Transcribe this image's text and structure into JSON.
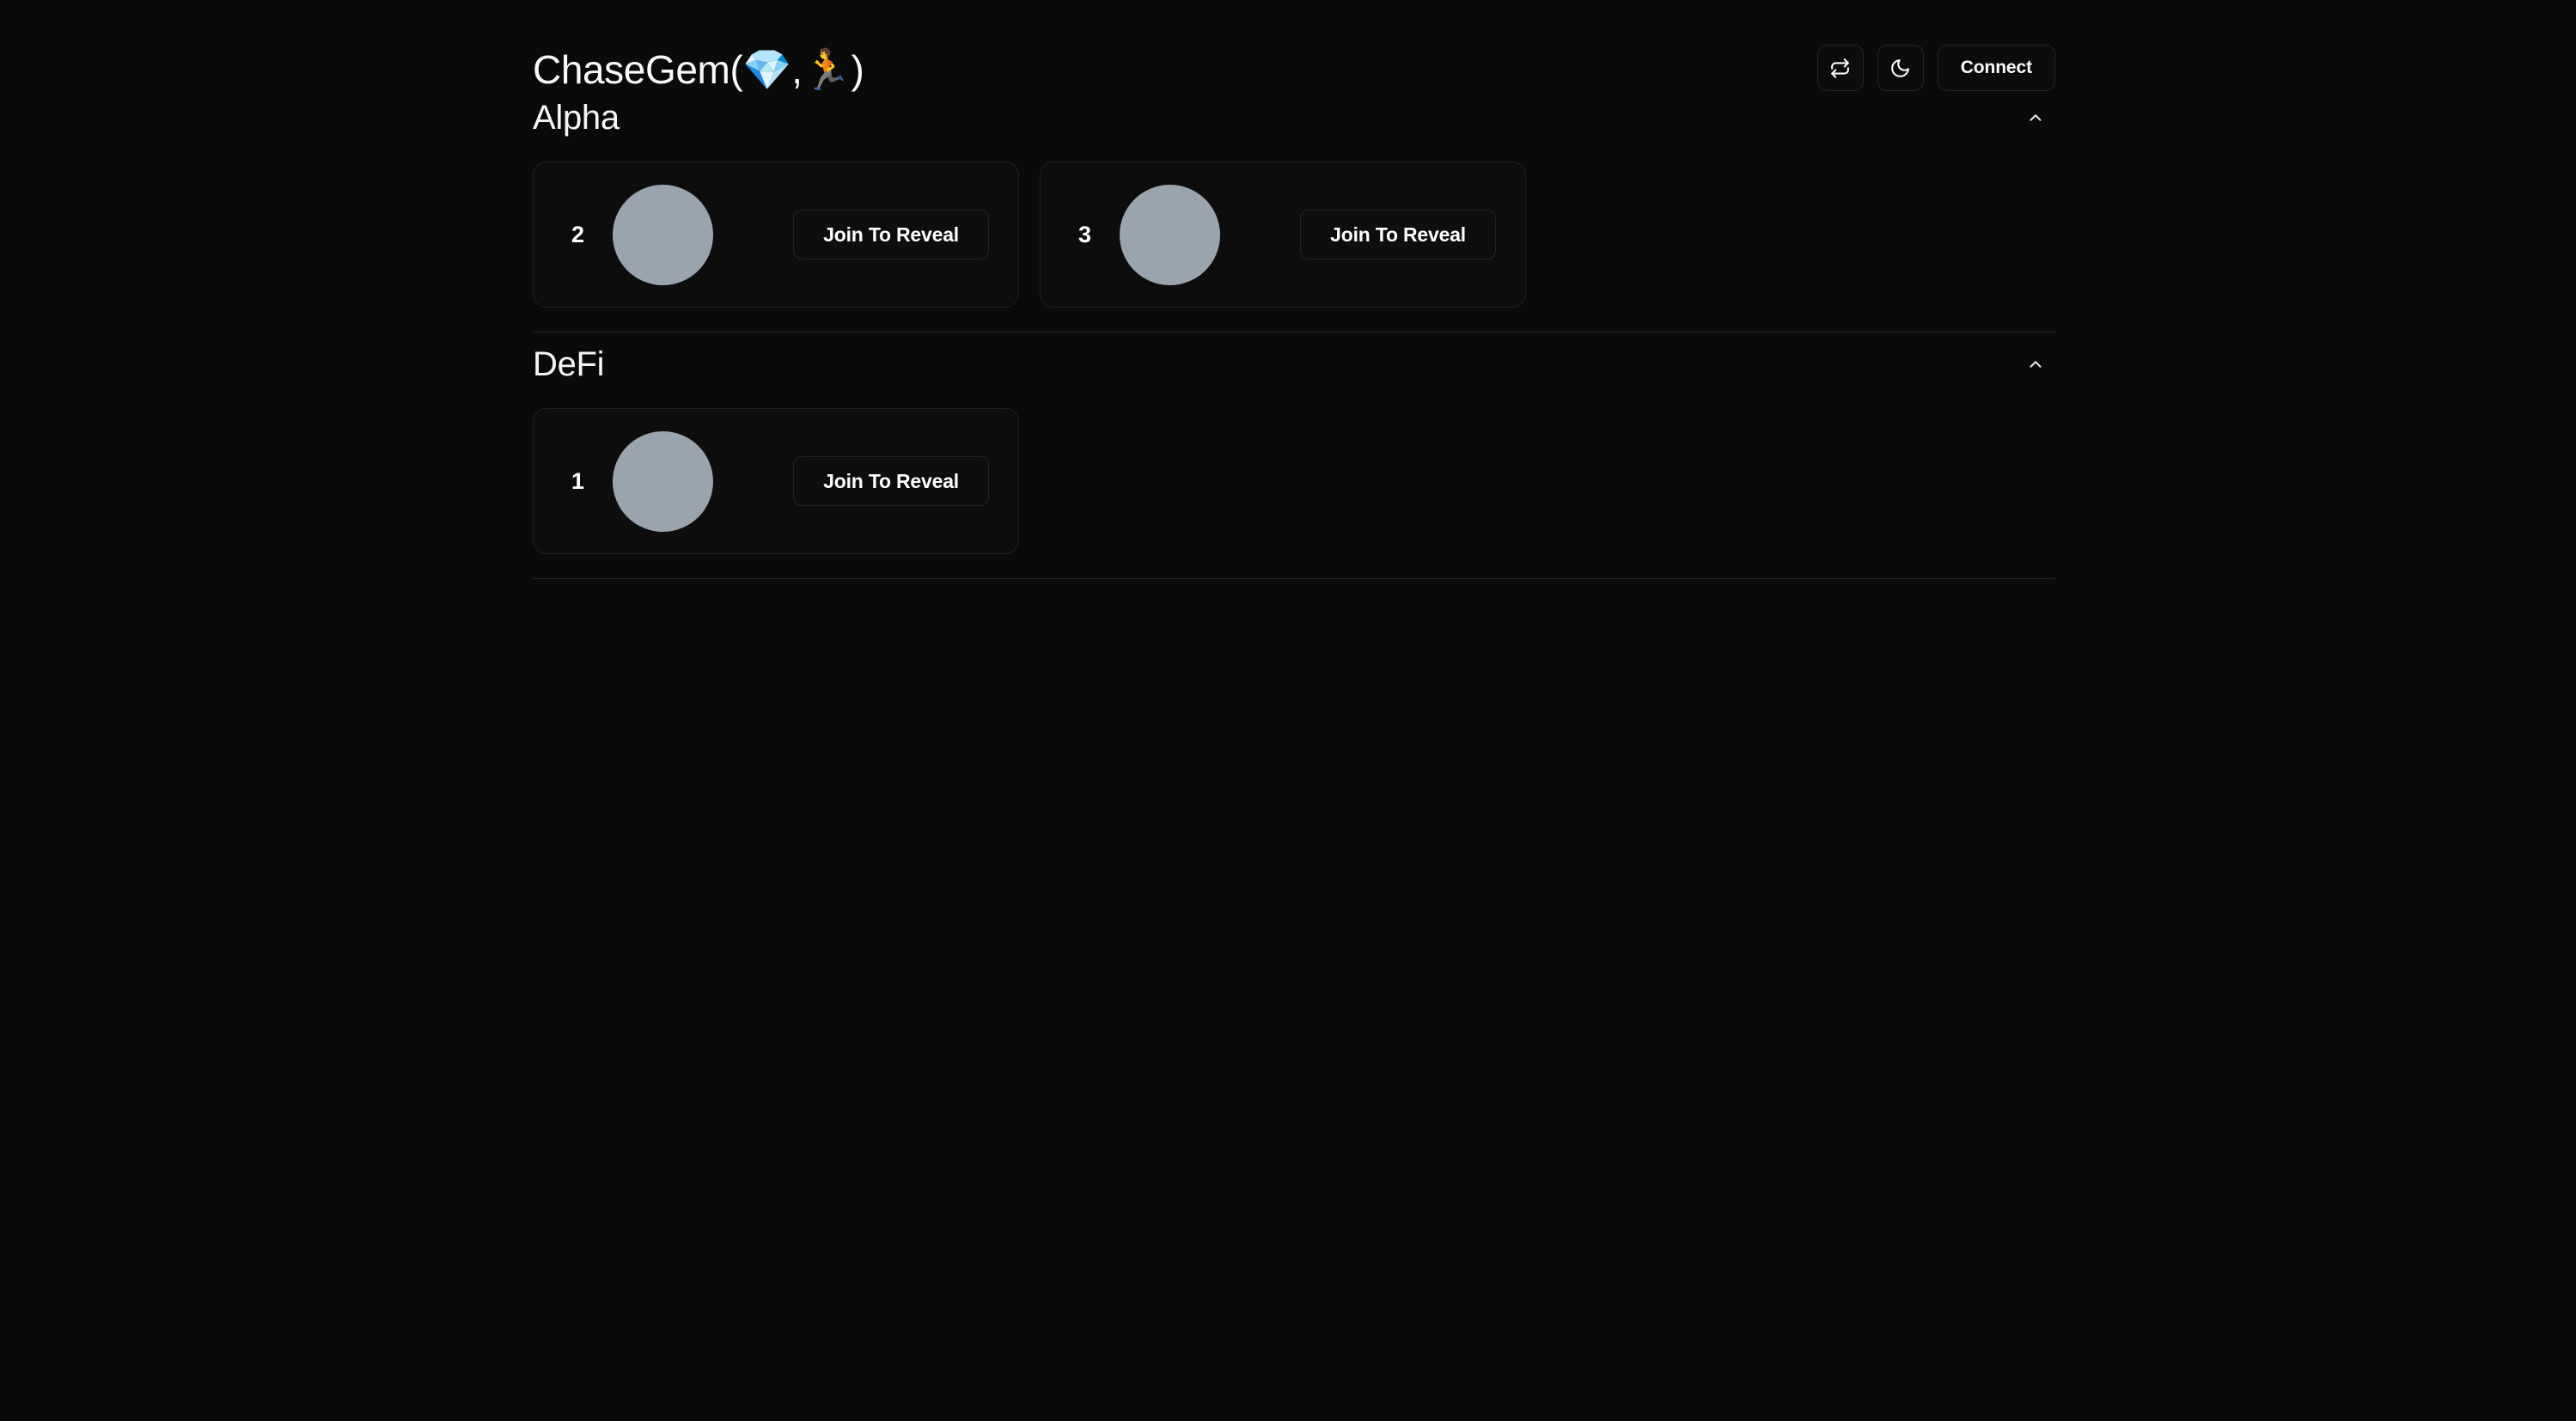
{
  "app": {
    "title": "ChaseGem(💎,🏃)",
    "background_color": "#0a0a0a",
    "accent_color": "#fafafa"
  },
  "header": {
    "actions": [
      {
        "name": "refresh-button",
        "icon": "refresh-icon",
        "label": ""
      },
      {
        "name": "dark-mode-button",
        "icon": "moon-icon",
        "label": ""
      }
    ],
    "connect_label": "Connect"
  },
  "sections": [
    {
      "title": "Alpha",
      "collapse_icon": "chevron-up-icon",
      "expanded": true,
      "cards": [
        {
          "rank": "2",
          "avatar_color": "#9aa4ae",
          "action_label": "Join To Reveal"
        },
        {
          "rank": "3",
          "avatar_color": "#9aa4ae",
          "action_label": "Join To Reveal"
        }
      ]
    },
    {
      "title": "DeFi",
      "collapse_icon": "chevron-up-icon",
      "expanded": true,
      "cards": [
        {
          "rank": "1",
          "avatar_color": "#9aa4ae",
          "action_label": "Join To Reveal"
        }
      ]
    }
  ]
}
